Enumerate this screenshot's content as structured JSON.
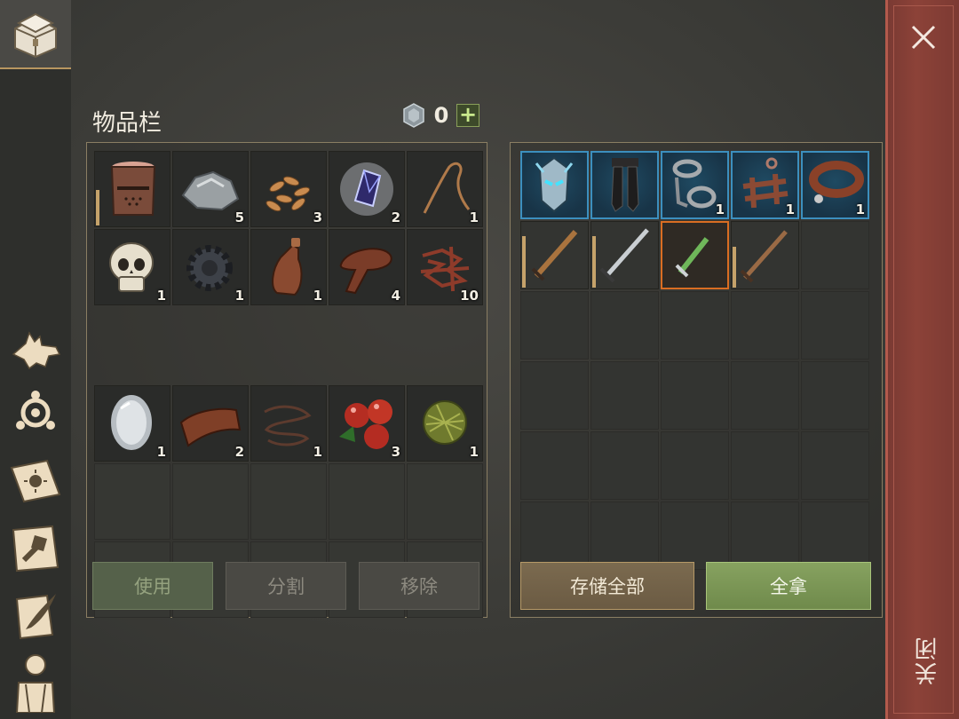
{
  "inventory": {
    "title": "物品栏",
    "currency_icon": "silver-coin-icon",
    "currency_count": "0",
    "add_label": "+",
    "slots": [
      {
        "name": "knight-helmet",
        "qty": "",
        "durability": 0.5
      },
      {
        "name": "stone",
        "qty": "5"
      },
      {
        "name": "seeds",
        "qty": "3"
      },
      {
        "name": "crystal",
        "qty": "2"
      },
      {
        "name": "rope",
        "qty": "1"
      },
      {
        "name": "skull",
        "qty": "1"
      },
      {
        "name": "gear",
        "qty": "1"
      },
      {
        "name": "leather-bottle",
        "qty": "1"
      },
      {
        "name": "leather-strap",
        "qty": "4"
      },
      {
        "name": "tangled-wire",
        "qty": "10"
      },
      {
        "name": "mirror",
        "qty": "1"
      },
      {
        "name": "leather-scroll",
        "qty": "2"
      },
      {
        "name": "cord",
        "qty": "1"
      },
      {
        "name": "berries",
        "qty": "3"
      },
      {
        "name": "hay-ball",
        "qty": "1"
      }
    ],
    "buttons": {
      "use": "使用",
      "split": "分割",
      "remove": "移除"
    }
  },
  "storage": {
    "slots": [
      {
        "name": "ice-mask",
        "qty": "",
        "style": "blue"
      },
      {
        "name": "dark-boots",
        "qty": "",
        "style": "blue"
      },
      {
        "name": "iron-chains",
        "qty": "1",
        "style": "blue"
      },
      {
        "name": "wooden-trap",
        "qty": "1",
        "style": "blue"
      },
      {
        "name": "leather-collar",
        "qty": "1",
        "style": "blue"
      },
      {
        "name": "bronze-sword",
        "qty": "",
        "durability": 0.8
      },
      {
        "name": "steel-sword",
        "qty": "",
        "durability": 0.8
      },
      {
        "name": "poison-dagger",
        "qty": "",
        "style": "orange"
      },
      {
        "name": "wooden-sword",
        "qty": "",
        "durability": 0.6
      }
    ],
    "buttons": {
      "store_all": "存储全部",
      "take_all": "全拿"
    }
  },
  "close": {
    "label": "关闭"
  }
}
